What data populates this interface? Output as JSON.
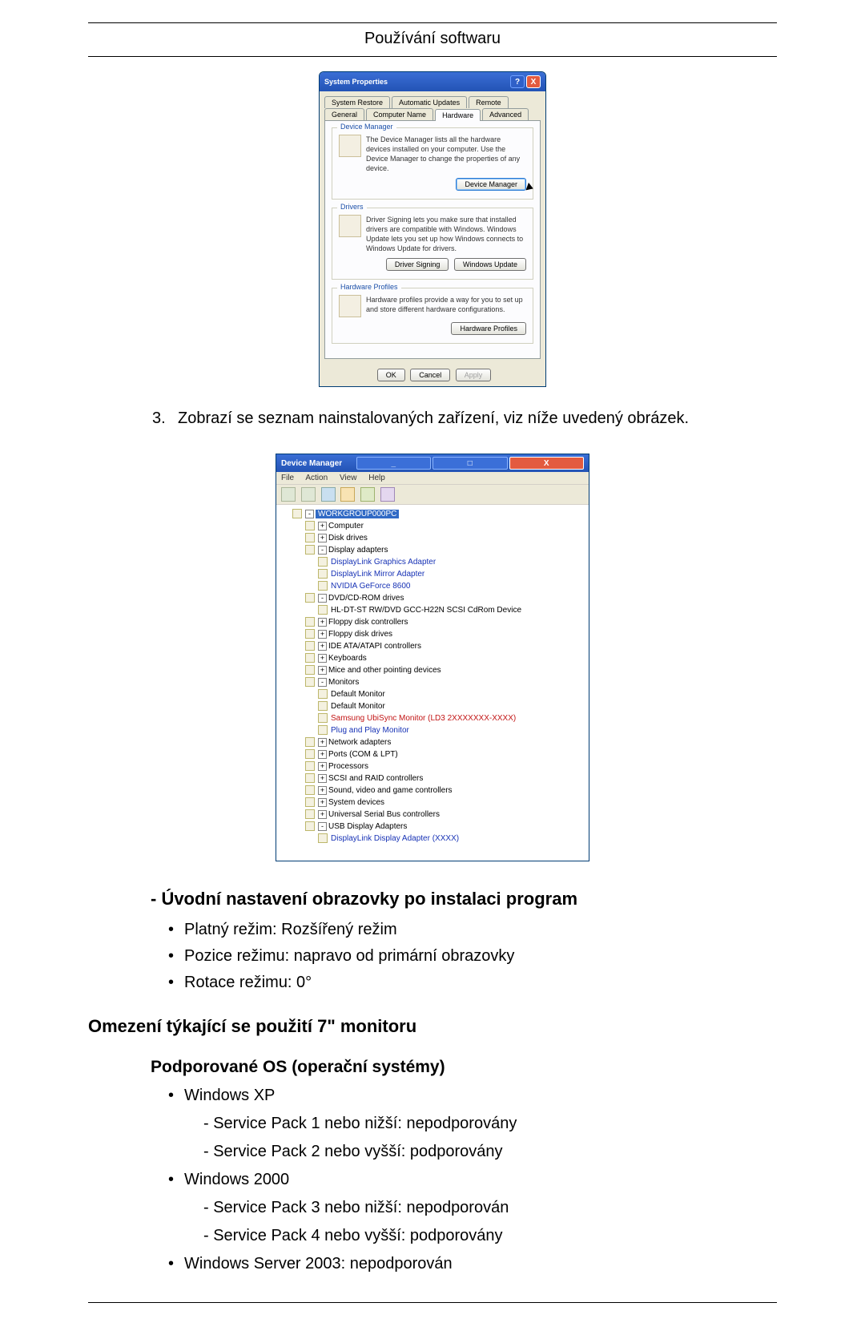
{
  "header": {
    "title": "Používání softwaru"
  },
  "sysprops": {
    "title": "System Properties",
    "help_glyph": "?",
    "close_glyph": "X",
    "tabs_row1": [
      "System Restore",
      "Automatic Updates",
      "Remote"
    ],
    "tabs_row2": [
      "General",
      "Computer Name",
      "Hardware",
      "Advanced"
    ],
    "grp_devmgr": {
      "legend": "Device Manager",
      "text": "The Device Manager lists all the hardware devices installed on your computer. Use the Device Manager to change the properties of any device.",
      "button": "Device Manager"
    },
    "grp_drivers": {
      "legend": "Drivers",
      "text": "Driver Signing lets you make sure that installed drivers are compatible with Windows. Windows Update lets you set up how Windows connects to Windows Update for drivers.",
      "btn1": "Driver Signing",
      "btn2": "Windows Update"
    },
    "grp_hw": {
      "legend": "Hardware Profiles",
      "text": "Hardware profiles provide a way for you to set up and store different hardware configurations.",
      "button": "Hardware Profiles"
    },
    "footer": {
      "ok": "OK",
      "cancel": "Cancel",
      "apply": "Apply"
    }
  },
  "step": {
    "num": "3.",
    "text": "Zobrazí se seznam nainstalovaných zařízení, viz níže uvedený obrázek."
  },
  "devmgr": {
    "title": "Device Manager",
    "menu": [
      "File",
      "Action",
      "View",
      "Help"
    ],
    "root": "WORKGROUP000PC",
    "items": [
      {
        "label": "Computer"
      },
      {
        "label": "Disk drives"
      },
      {
        "label": "Display adapters",
        "open": true,
        "children": [
          {
            "label": "DisplayLink Graphics Adapter",
            "cls": "node-dis"
          },
          {
            "label": "DisplayLink Mirror Adapter",
            "cls": "node-dis"
          },
          {
            "label": "NVIDIA GeForce 8600",
            "cls": "node-dis"
          }
        ]
      },
      {
        "label": "DVD/CD-ROM drives",
        "open": true,
        "children": [
          {
            "label": "HL-DT-ST RW/DVD GCC-H22N SCSI CdRom Device",
            "cls": ""
          }
        ]
      },
      {
        "label": "Floppy disk controllers"
      },
      {
        "label": "Floppy disk drives"
      },
      {
        "label": "IDE ATA/ATAPI controllers"
      },
      {
        "label": "Keyboards"
      },
      {
        "label": "Mice and other pointing devices"
      },
      {
        "label": "Monitors",
        "open": true,
        "children": [
          {
            "label": "Default Monitor",
            "cls": ""
          },
          {
            "label": "Default Monitor",
            "cls": ""
          },
          {
            "label": "Samsung UbiSync Monitor (LD3 2XXXXXXX-XXXX)",
            "cls": "node-red"
          },
          {
            "label": "Plug and Play Monitor",
            "cls": "node-dis"
          }
        ]
      },
      {
        "label": "Network adapters"
      },
      {
        "label": "Ports (COM & LPT)"
      },
      {
        "label": "Processors"
      },
      {
        "label": "SCSI and RAID controllers"
      },
      {
        "label": "Sound, video and game controllers"
      },
      {
        "label": "System devices"
      },
      {
        "label": "Universal Serial Bus controllers"
      },
      {
        "label": "USB Display Adapters",
        "open": true,
        "children": [
          {
            "label": "DisplayLink Display Adapter (XXXX)",
            "cls": "node-dis"
          }
        ]
      }
    ]
  },
  "h_initial": "- Úvodní nastavení obrazovky po instalaci program",
  "bullets_initial": [
    "Platný režim: Rozšířený režim",
    "Pozice režimu: napravo od primární obrazovky",
    "Rotace režimu: 0°"
  ],
  "h_limit": "Omezení týkající se použití 7\" monitoru",
  "h_os": "Podporované OS (operační systémy)",
  "os_list": [
    {
      "label": "Windows XP",
      "sub": [
        "- Service Pack 1 nebo nižší: nepodporovány",
        "- Service Pack 2 nebo vyšší: podporovány"
      ]
    },
    {
      "label": "Windows 2000",
      "sub": [
        "- Service Pack 3 nebo nižší: nepodporován",
        "- Service Pack 4 nebo vyšší: podporovány"
      ]
    },
    {
      "label": "Windows Server 2003: nepodporován"
    }
  ]
}
